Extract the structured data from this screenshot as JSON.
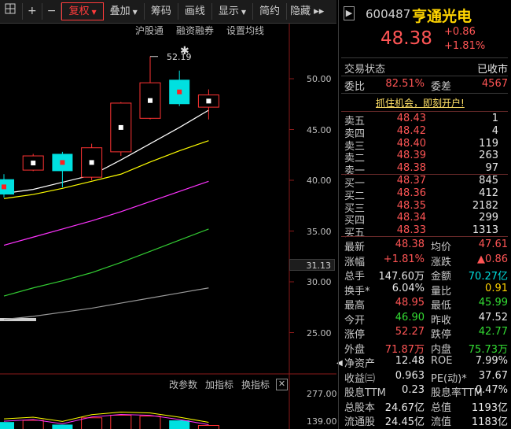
{
  "toolbar": {
    "items": [
      {
        "label": "",
        "icon": "grid"
      },
      {
        "label": "+",
        "icon": "plus"
      },
      {
        "label": "−",
        "icon": "minus"
      },
      {
        "label": "复权",
        "dropdown": true,
        "active": true
      },
      {
        "label": "叠加",
        "dropdown": true
      },
      {
        "label": "筹码"
      },
      {
        "label": "画线"
      },
      {
        "label": "显示",
        "dropdown": true
      },
      {
        "label": "简约"
      },
      {
        "label": "隐藏 ▸▸"
      }
    ]
  },
  "chart_tools": [
    "沪股通",
    "融资融券",
    "设置均线"
  ],
  "indicator_tools": [
    "改参数",
    "加指标",
    "换指标"
  ],
  "chart_data": {
    "type": "candlestick",
    "y_ticks": [
      "50.00",
      "45.00",
      "40.00",
      "35.00",
      "30.00",
      "25.00"
    ],
    "current_price_label": "31.13",
    "high_marker": "52.19",
    "volume_ticks": [
      "277.00",
      "139.00"
    ],
    "candles": [
      {
        "open": 38.6,
        "close": 40.1,
        "high": 40.6,
        "low": 38.3,
        "color": "cyan"
      },
      {
        "open": 41.0,
        "close": 42.4,
        "high": 42.6,
        "low": 40.9,
        "color": "red"
      },
      {
        "open": 42.6,
        "close": 40.9,
        "high": 42.8,
        "low": 39.3,
        "color": "cyan"
      },
      {
        "open": 40.3,
        "close": 43.2,
        "high": 43.6,
        "low": 40.0,
        "color": "red"
      },
      {
        "open": 42.8,
        "close": 47.6,
        "high": 47.7,
        "low": 42.4,
        "color": "red"
      },
      {
        "open": 46.1,
        "close": 49.6,
        "high": 52.19,
        "low": 46.0,
        "color": "red"
      },
      {
        "open": 49.9,
        "close": 47.5,
        "high": 50.8,
        "low": 47.3,
        "color": "cyan"
      },
      {
        "open": 47.2,
        "close": 48.4,
        "high": 48.95,
        "low": 45.99,
        "color": "red"
      }
    ],
    "ma_lines": [
      {
        "color": "#ffffff",
        "values": [
          38.7,
          39.1,
          39.8,
          40.5,
          42.0,
          43.6,
          45.2,
          46.9
        ]
      },
      {
        "color": "#ffff00",
        "values": [
          38.2,
          38.6,
          39.2,
          39.9,
          40.6,
          41.8,
          42.9,
          43.9
        ]
      },
      {
        "color": "#ff33ff",
        "values": [
          33.6,
          34.4,
          35.2,
          36.0,
          36.9,
          37.9,
          38.9,
          39.9
        ]
      },
      {
        "color": "#33cc33",
        "values": [
          28.6,
          29.4,
          30.1,
          30.9,
          31.9,
          33.0,
          34.1,
          35.2
        ]
      },
      {
        "color": "#9a9a9a",
        "values": [
          26.3,
          26.6,
          27.0,
          27.4,
          27.9,
          28.4,
          28.9,
          29.4
        ]
      }
    ],
    "volumes": [
      {
        "value": 110,
        "color": "cyan"
      },
      {
        "value": 120,
        "color": "red"
      },
      {
        "value": 95,
        "color": "cyan"
      },
      {
        "value": 135,
        "color": "red"
      },
      {
        "value": 150,
        "color": "red"
      },
      {
        "value": 145,
        "color": "red"
      },
      {
        "value": 120,
        "color": "cyan"
      },
      {
        "value": 90,
        "color": "red"
      }
    ]
  },
  "stock": {
    "code": "600487",
    "name": "亨通光电",
    "price": "48.38",
    "change": "+0.86",
    "change_pct": "+1.81%"
  },
  "status": {
    "label": "交易状态",
    "value": "已收市"
  },
  "ratio": {
    "wb_label": "委比",
    "wb": "82.51%",
    "wc_label": "委差",
    "wc": "4567"
  },
  "promo": "抓住机会，即刻开户!",
  "asks": [
    {
      "label": "卖五",
      "price": "48.43",
      "vol": "1"
    },
    {
      "label": "卖四",
      "price": "48.42",
      "vol": "4"
    },
    {
      "label": "卖三",
      "price": "48.40",
      "vol": "119"
    },
    {
      "label": "卖二",
      "price": "48.39",
      "vol": "263"
    },
    {
      "label": "卖一",
      "price": "48.38",
      "vol": "97"
    }
  ],
  "bids": [
    {
      "label": "买一",
      "price": "48.37",
      "vol": "845"
    },
    {
      "label": "买二",
      "price": "48.36",
      "vol": "412"
    },
    {
      "label": "买三",
      "price": "48.35",
      "vol": "2182"
    },
    {
      "label": "买四",
      "price": "48.34",
      "vol": "299"
    },
    {
      "label": "买五",
      "price": "48.33",
      "vol": "1313"
    }
  ],
  "stats": [
    {
      "l1": "最新",
      "v1": "48.38",
      "c1": "red",
      "l2": "均价",
      "v2": "47.61",
      "c2": "red"
    },
    {
      "l1": "涨幅",
      "v1": "+1.81%",
      "c1": "red",
      "l2": "涨跌",
      "v2": "▲0.86",
      "c2": "red"
    },
    {
      "l1": "总手",
      "v1": "147.60万",
      "c1": "white",
      "l2": "金额",
      "v2": "70.27亿",
      "c2": "cyan"
    },
    {
      "l1": "换手*",
      "v1": "6.04%",
      "c1": "white",
      "l2": "量比",
      "v2": "0.91",
      "c2": "yel"
    },
    {
      "l1": "最高",
      "v1": "48.95",
      "c1": "red",
      "l2": "最低",
      "v2": "45.99",
      "c2": "green"
    },
    {
      "l1": "今开",
      "v1": "46.90",
      "c1": "green",
      "l2": "昨收",
      "v2": "47.52",
      "c2": "white"
    },
    {
      "l1": "涨停",
      "v1": "52.27",
      "c1": "red",
      "l2": "跌停",
      "v2": "42.77",
      "c2": "green"
    },
    {
      "l1": "外盘",
      "v1": "71.87万",
      "c1": "red",
      "l2": "内盘",
      "v2": "75.73万",
      "c2": "green"
    },
    {
      "l1": "净资产",
      "v1": "12.48",
      "c1": "white",
      "l2": "ROE",
      "v2": "7.99%",
      "c2": "white"
    },
    {
      "l1": "收益㈢",
      "v1": "0.963",
      "c1": "white",
      "l2": "PE(动)*",
      "v2": "37.67",
      "c2": "white"
    },
    {
      "l1": "股息TTM",
      "v1": "0.23",
      "c1": "white",
      "l2": "股息率TTM",
      "v2": "0.47%",
      "c2": "white"
    },
    {
      "l1": "总股本",
      "v1": "24.67亿",
      "c1": "white",
      "l2": "总值",
      "v2": "1193亿",
      "c2": "white"
    },
    {
      "l1": "流通股",
      "v1": "24.45亿",
      "c1": "white",
      "l2": "流值",
      "v2": "1183亿",
      "c2": "white"
    }
  ],
  "colors": {
    "up": "#ff3333",
    "down": "#00e0e0",
    "bg": "#000000"
  }
}
